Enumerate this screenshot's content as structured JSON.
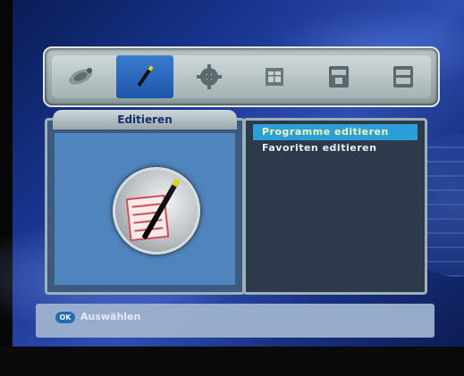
{
  "menu": {
    "tabs": [
      {
        "icon": "satellite-icon",
        "active": false
      },
      {
        "icon": "pencil-icon",
        "active": true
      },
      {
        "icon": "gear-icon",
        "active": false
      },
      {
        "icon": "calendar-icon",
        "active": false
      },
      {
        "icon": "media-box-icon",
        "active": false
      },
      {
        "icon": "display-box-icon",
        "active": false
      }
    ]
  },
  "left_panel": {
    "title": "Editieren",
    "illustration": "edit-pen-paper-icon"
  },
  "right_panel": {
    "items": [
      {
        "label": "Programme editieren",
        "selected": true
      },
      {
        "label": "Favoriten editieren",
        "selected": false
      }
    ]
  },
  "footer": {
    "ok_key": "OK",
    "action": "Auswählen"
  },
  "colors": {
    "selected_bg": "#2ba0d8",
    "selected_text": "#f4f6b0",
    "active_tab": "#1d56ab"
  }
}
